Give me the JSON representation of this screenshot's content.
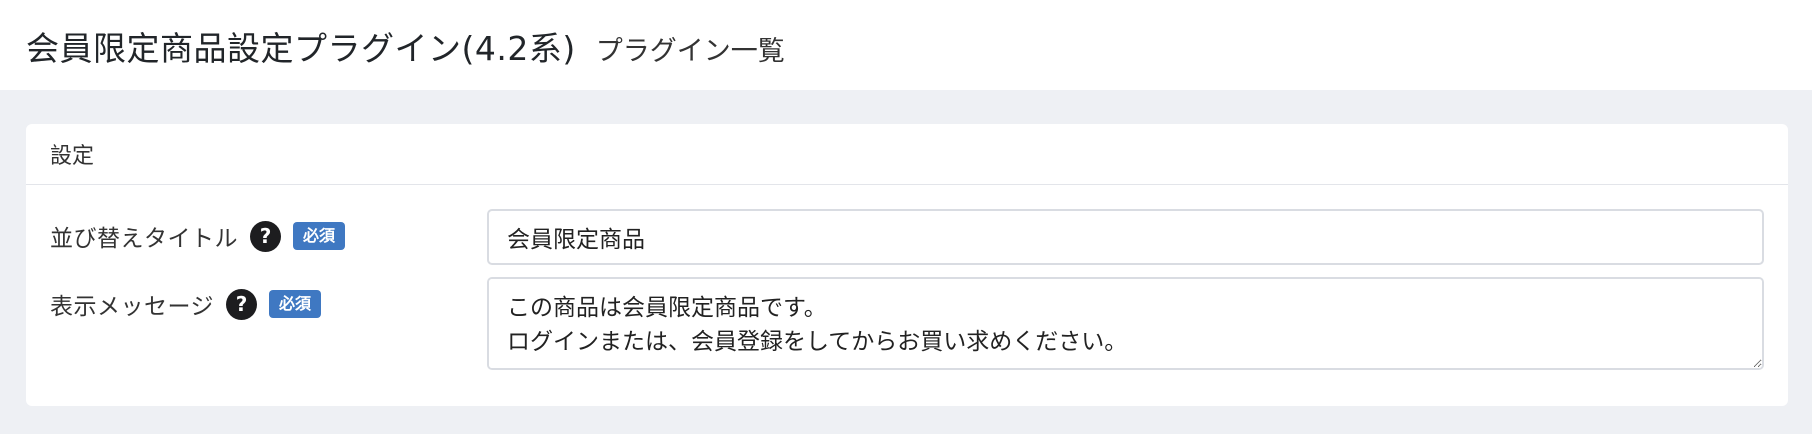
{
  "header": {
    "title": "会員限定商品設定プラグイン(4.2系)",
    "subtitle": "プラグイン一覧"
  },
  "card": {
    "title": "設定"
  },
  "form": {
    "sort_title": {
      "label": "並び替えタイトル",
      "help_icon": "question-circle-icon",
      "required_badge": "必須",
      "value": "会員限定商品"
    },
    "message": {
      "label": "表示メッセージ",
      "help_icon": "question-circle-icon",
      "required_badge": "必須",
      "value": "この商品は会員限定商品です。\nログインまたは、会員登録をしてからお買い求めください。"
    }
  }
}
